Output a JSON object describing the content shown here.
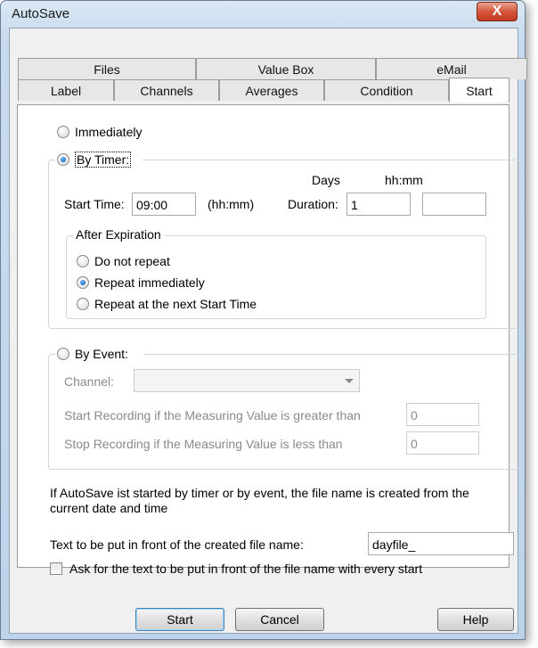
{
  "window": {
    "title": "AutoSave",
    "close_glyph": "X"
  },
  "tabs": {
    "row1": [
      "Files",
      "Value Box",
      "eMail"
    ],
    "row2": [
      "Label",
      "Channels",
      "Averages",
      "Condition",
      "Start"
    ],
    "active": "Start"
  },
  "start": {
    "immediately_label": "Immediately",
    "by_timer_label": "By Timer:",
    "start_time_label": "Start Time:",
    "start_time_value": "09:00",
    "start_time_unit": "(hh:mm)",
    "duration_label": "Duration:",
    "days_header": "Days",
    "hhmm_header": "hh:mm",
    "duration_days_value": "1",
    "duration_hhmm_value": "",
    "after_expiration": {
      "title": "After Expiration",
      "options": [
        "Do not repeat",
        "Repeat immediately",
        "Repeat at the next Start Time"
      ],
      "selected": "Repeat immediately"
    },
    "by_event_label": "By Event:",
    "channel_label": "Channel:",
    "channel_value": "",
    "start_recording_label": "Start Recording if the Measuring Value is greater than",
    "start_recording_value": "0",
    "stop_recording_label": "Stop Recording if the Measuring Value is less than",
    "stop_recording_value": "0",
    "info_text": "If AutoSave ist started by timer or by event, the file name is created from the current date and time",
    "prefix_label": "Text to be put in front of the created file name:",
    "prefix_value": "dayfile_",
    "ask_prefix_label": "Ask for the text to be put in front of the file name with every start",
    "selected_mode": "By Timer:"
  },
  "buttons": {
    "start": "Start",
    "cancel": "Cancel",
    "help": "Help"
  }
}
